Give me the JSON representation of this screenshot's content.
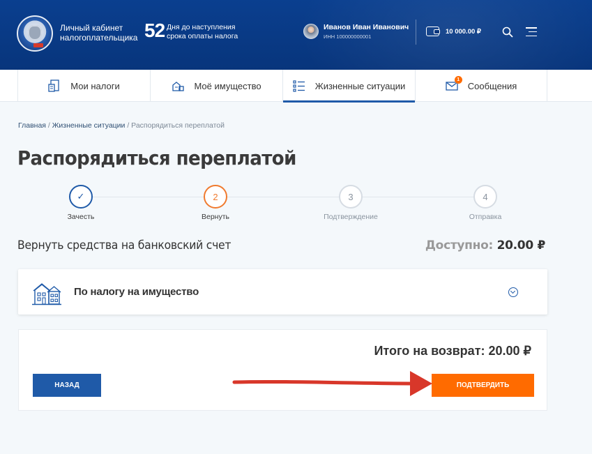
{
  "header": {
    "cabinet_title": "Личный кабинет налогоплательщика",
    "days_number": "52",
    "days_text": "Дня до наступления срока оплаты налога",
    "user_name": "Иванов Иван Иванович",
    "user_inn": "ИНН 100000000001",
    "balance": "10 000.00 ₽"
  },
  "tabs": [
    {
      "label": "Мои налоги",
      "icon": "taxes-document-icon"
    },
    {
      "label": "Моё имущество",
      "icon": "property-icon"
    },
    {
      "label": "Жизненные ситуации",
      "icon": "list-icon",
      "active": true
    },
    {
      "label": "Сообщения",
      "icon": "envelope-icon",
      "badge": "1"
    }
  ],
  "breadcrumb": {
    "home": "Главная",
    "sep1": " / ",
    "section": "Жизненные ситуации",
    "sep2": " / ",
    "current": "Распорядиться переплатой"
  },
  "page_title": "Распорядиться переплатой",
  "stepper": [
    {
      "mark": "✓",
      "label": "Зачесть",
      "state": "done"
    },
    {
      "mark": "2",
      "label": "Вернуть",
      "state": "current"
    },
    {
      "mark": "3",
      "label": "Подтверждение",
      "state": "pending"
    },
    {
      "mark": "4",
      "label": "Отправка",
      "state": "pending"
    }
  ],
  "section_title": "Вернуть средства на банковский счет",
  "available": {
    "label": "Доступно:",
    "value": "20.00 ₽"
  },
  "tax_item": {
    "label": "По налогу на имущество"
  },
  "summary": {
    "total": "Итого на возврат: 20.00 ₽",
    "back_label": "НАЗАД",
    "confirm_label": "ПОДТВЕРДИТЬ"
  },
  "colors": {
    "header_blue": "#0a3f8f",
    "accent_blue": "#1f5aa8",
    "accent_orange": "#ff6b00",
    "annotation_red": "#d8372a"
  }
}
